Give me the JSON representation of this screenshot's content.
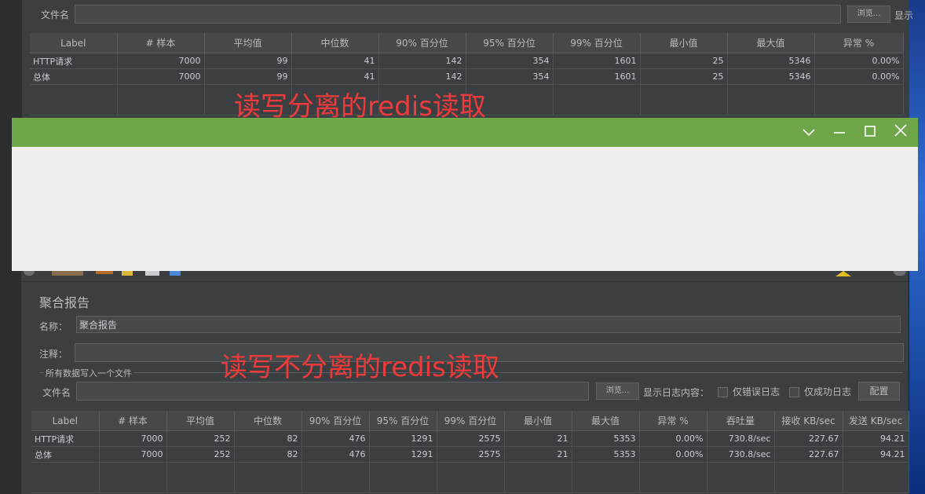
{
  "top_panel": {
    "file_label": "文件名",
    "browse_label": "浏览...",
    "show_label": "显示"
  },
  "top_table": {
    "headers": [
      "Label",
      "# 样本",
      "平均值",
      "中位数",
      "90% 百分位",
      "95% 百分位",
      "99% 百分位",
      "最小值",
      "最大值",
      "异常 %"
    ],
    "rows": [
      [
        "HTTP请求",
        "7000",
        "99",
        "41",
        "142",
        "354",
        "1601",
        "25",
        "5346",
        "0.00%"
      ],
      [
        "总体",
        "7000",
        "99",
        "41",
        "142",
        "354",
        "1601",
        "25",
        "5346",
        "0.00%"
      ]
    ]
  },
  "annotation_top": "读写分离的redis读取",
  "window": {
    "accent": "#70a64a",
    "controls": [
      "chevron-down-icon",
      "minimize-icon",
      "maximize-icon",
      "close-icon"
    ]
  },
  "bottom_panel": {
    "title": "聚合报告",
    "name_label": "名称：",
    "name_value": "聚合报告",
    "comment_label": "注释：",
    "section_label": "所有数据写入一个文件",
    "file_label": "文件名",
    "browse_label": "浏览...",
    "log_label": "显示日志内容：",
    "error_only_label": "仅错误日志",
    "success_only_label": "仅成功日志",
    "config_label": "配置"
  },
  "annotation_bottom": "读写不分离的redis读取",
  "bottom_table": {
    "headers": [
      "Label",
      "# 样本",
      "平均值",
      "中位数",
      "90% 百分位",
      "95% 百分位",
      "99% 百分位",
      "最小值",
      "最大值",
      "异常 %",
      "吞吐量",
      "接收 KB/sec",
      "发送 KB/sec"
    ],
    "rows": [
      [
        "HTTP请求",
        "7000",
        "252",
        "82",
        "476",
        "1291",
        "2575",
        "21",
        "5353",
        "0.00%",
        "730.8/sec",
        "227.67",
        "94.21"
      ],
      [
        "总体",
        "7000",
        "252",
        "82",
        "476",
        "1291",
        "2575",
        "21",
        "5353",
        "0.00%",
        "730.8/sec",
        "227.67",
        "94.21"
      ]
    ]
  }
}
